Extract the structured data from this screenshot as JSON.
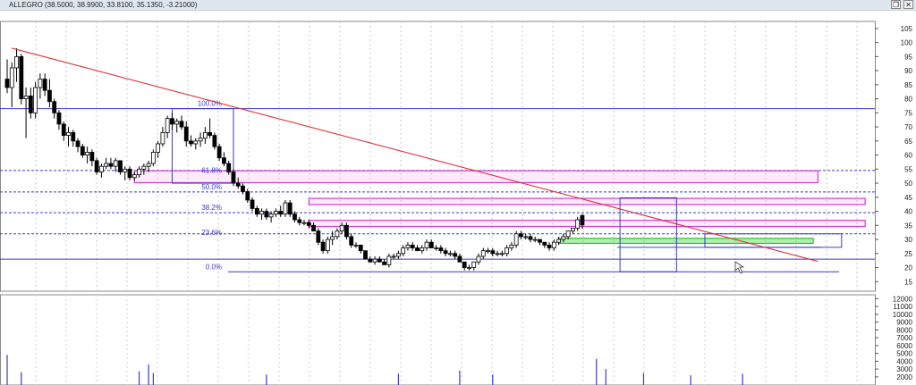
{
  "window": {
    "title": "ALLEGRO (38.5000, 38.9900, 33.8100, 35.1350, -3.21000)",
    "restore_glyph": "❐",
    "close_glyph": "✕",
    "restore_icon": "restore-window-icon",
    "close_icon": "close-window-icon"
  },
  "chart_data": [
    {
      "type": "candlestick",
      "symbol": "ALLEGRO",
      "header_values": {
        "open": 38.5,
        "high": 38.99,
        "low": 33.81,
        "close": 35.135,
        "change": -3.21
      },
      "y_ticks": [
        15,
        20,
        25,
        30,
        35,
        40,
        45,
        50,
        55,
        60,
        65,
        70,
        75,
        80,
        85,
        90,
        95,
        100,
        105
      ],
      "ylim": [
        11.6,
        107.5
      ],
      "grid": "vertical-dashed",
      "y_axis_side": "right",
      "colors": {
        "up_candle": "#ffffff",
        "down_candle": "#000000",
        "trendline": "#e0303a",
        "fib_levels": "#3b3bc8",
        "zones": "#d83ad8",
        "green_zone": "#22cc22",
        "volume": "#3b3bc8"
      },
      "fibonacci": [
        {
          "label": "100.0%",
          "price": 76.5
        },
        {
          "label": "61.8%",
          "price": 52.8
        },
        {
          "label": "50.0%",
          "price": 46.9
        },
        {
          "label": "38.2%",
          "price": 39.5
        },
        {
          "label": "23.6%",
          "price": 30.6
        },
        {
          "label": "0.0%",
          "price": 18.5
        }
      ],
      "horizontal_lines": [
        {
          "price": 76.5,
          "style": "solid"
        },
        {
          "price": 54.5,
          "style": "dashed"
        },
        {
          "price": 46.9,
          "style": "dashed"
        },
        {
          "price": 39.5,
          "style": "dashed"
        },
        {
          "price": 32.0,
          "style": "dashed"
        },
        {
          "price": 23.0,
          "style": "solid"
        },
        {
          "price": 27.2,
          "style": "solid"
        },
        {
          "price": 18.5,
          "style": "solid"
        }
      ],
      "zones": [
        {
          "bar_from": 27,
          "bar_to": 172,
          "price_low": 50.2,
          "price_high": 54.4,
          "color": "magenta"
        },
        {
          "bar_from": 64,
          "bar_to": 182,
          "price_low": 42.4,
          "price_high": 44.6,
          "color": "magenta"
        },
        {
          "bar_from": 64,
          "bar_to": 182,
          "price_low": 34.6,
          "price_high": 36.8,
          "color": "magenta"
        },
        {
          "bar_from": 117,
          "bar_to": 171,
          "price_low": 28.6,
          "price_high": 30.4,
          "color": "green"
        }
      ],
      "boxes": [
        {
          "bar_from": 35,
          "bar_to": 48,
          "price_low": 50.0,
          "price_high": 76.5
        },
        {
          "bar_from": 130,
          "bar_to": 142,
          "price_low": 18.5,
          "price_high": 44.8
        },
        {
          "bar_from": 148,
          "bar_to": 177,
          "price_low": 27.2,
          "price_high": 32.0
        }
      ],
      "trendline": {
        "from": {
          "bar": 1,
          "price": 98.0
        },
        "to": {
          "bar": 172,
          "price": 22.2
        }
      },
      "candles": [
        [
          87,
          94,
          82,
          84
        ],
        [
          84,
          93,
          77,
          91
        ],
        [
          91,
          98,
          86,
          95
        ],
        [
          95,
          96,
          78,
          80
        ],
        [
          80,
          84,
          66,
          81
        ],
        [
          81,
          84,
          73,
          75
        ],
        [
          75,
          86,
          73,
          84
        ],
        [
          84,
          89,
          80,
          87
        ],
        [
          87,
          89,
          81,
          83
        ],
        [
          83,
          87,
          77,
          79
        ],
        [
          79,
          80,
          73,
          75
        ],
        [
          75,
          76,
          69,
          71
        ],
        [
          71,
          72,
          65,
          67
        ],
        [
          67,
          70,
          63,
          68
        ],
        [
          68,
          69,
          63,
          65
        ],
        [
          65,
          66,
          61,
          63
        ],
        [
          63,
          64,
          59,
          60
        ],
        [
          60,
          63,
          57,
          61
        ],
        [
          61,
          62,
          56,
          58
        ],
        [
          58,
          59,
          53,
          54
        ],
        [
          54,
          57,
          52,
          56
        ],
        [
          56,
          59,
          55,
          57
        ],
        [
          57,
          59,
          55,
          56
        ],
        [
          56,
          59,
          54,
          58
        ],
        [
          58,
          58,
          53,
          54
        ],
        [
          54,
          56,
          51,
          55
        ],
        [
          55,
          56,
          51,
          52
        ],
        [
          52,
          54,
          51,
          53
        ],
        [
          53,
          56,
          52,
          55
        ],
        [
          55,
          57,
          53,
          56
        ],
        [
          56,
          58,
          54,
          57
        ],
        [
          57,
          62,
          56,
          61
        ],
        [
          61,
          65,
          59,
          64
        ],
        [
          64,
          70,
          63,
          68
        ],
        [
          68,
          74,
          66,
          73
        ],
        [
          73,
          75,
          69,
          71
        ],
        [
          71,
          73,
          68,
          72
        ],
        [
          72,
          74,
          69,
          70
        ],
        [
          70,
          72,
          63,
          65
        ],
        [
          65,
          67,
          63,
          64
        ],
        [
          64,
          66,
          62,
          65
        ],
        [
          65,
          68,
          63,
          66
        ],
        [
          66,
          70,
          64,
          68
        ],
        [
          68,
          73,
          66,
          67
        ],
        [
          67,
          68,
          62,
          63
        ],
        [
          63,
          64,
          58,
          59
        ],
        [
          59,
          61,
          56,
          57
        ],
        [
          57,
          58,
          53,
          54
        ],
        [
          54,
          55,
          49,
          50
        ],
        [
          50,
          52,
          48,
          49
        ],
        [
          49,
          50,
          46,
          47
        ],
        [
          47,
          48,
          43,
          44
        ],
        [
          44,
          45,
          40,
          41
        ],
        [
          41,
          42,
          38,
          39
        ],
        [
          39,
          41,
          37,
          40
        ],
        [
          40,
          41,
          37,
          38
        ],
        [
          38,
          40,
          36,
          39
        ],
        [
          39,
          41,
          38,
          40
        ],
        [
          40,
          42,
          38,
          39
        ],
        [
          39,
          44,
          38,
          43
        ],
        [
          43,
          44,
          38,
          39
        ],
        [
          39,
          40,
          36,
          37
        ],
        [
          37,
          38,
          35,
          36
        ],
        [
          36,
          37,
          35,
          36
        ],
        [
          36,
          37,
          34,
          35
        ],
        [
          35,
          36,
          33,
          33
        ],
        [
          33,
          34,
          28,
          29
        ],
        [
          29,
          30,
          25,
          26
        ],
        [
          26,
          31,
          25,
          30
        ],
        [
          30,
          33,
          28,
          31
        ],
        [
          31,
          34,
          30,
          33
        ],
        [
          33,
          36,
          32,
          35
        ],
        [
          35,
          36,
          30,
          31
        ],
        [
          31,
          32,
          27,
          28
        ],
        [
          28,
          29,
          27,
          28
        ],
        [
          28,
          28,
          25,
          26
        ],
        [
          26,
          26,
          23,
          23
        ],
        [
          23,
          24,
          22,
          22
        ],
        [
          22,
          24,
          21,
          23
        ],
        [
          23,
          24,
          22,
          22
        ],
        [
          22,
          23,
          21,
          21
        ],
        [
          21,
          25,
          20,
          24
        ],
        [
          24,
          25,
          23,
          24
        ],
        [
          24,
          26,
          23,
          25
        ],
        [
          25,
          28,
          24,
          27
        ],
        [
          27,
          29,
          26,
          28
        ],
        [
          28,
          29,
          26,
          27
        ],
        [
          27,
          28,
          26,
          26
        ],
        [
          26,
          28,
          25,
          27
        ],
        [
          27,
          30,
          26,
          29
        ],
        [
          29,
          30,
          27,
          27
        ],
        [
          27,
          28,
          26,
          27
        ],
        [
          27,
          28,
          25,
          26
        ],
        [
          26,
          27,
          24,
          25
        ],
        [
          25,
          26,
          24,
          25
        ],
        [
          25,
          26,
          23,
          24
        ],
        [
          24,
          25,
          22,
          22
        ],
        [
          22,
          22,
          19,
          20
        ],
        [
          20,
          21,
          19,
          20
        ],
        [
          20,
          22,
          19,
          22
        ],
        [
          22,
          25,
          21,
          24
        ],
        [
          24,
          27,
          23,
          26
        ],
        [
          26,
          27,
          25,
          26
        ],
        [
          26,
          27,
          24,
          25
        ],
        [
          25,
          26,
          24,
          25
        ],
        [
          25,
          26,
          24,
          25
        ],
        [
          25,
          28,
          24,
          27
        ],
        [
          27,
          29,
          26,
          28
        ],
        [
          28,
          33,
          27,
          32
        ],
        [
          32,
          33,
          30,
          31
        ],
        [
          31,
          32,
          30,
          31
        ],
        [
          31,
          32,
          29,
          30
        ],
        [
          30,
          31,
          29,
          30
        ],
        [
          30,
          30,
          28,
          29
        ],
        [
          29,
          29,
          27,
          28
        ],
        [
          28,
          29,
          26,
          27
        ],
        [
          27,
          30,
          26,
          29
        ],
        [
          29,
          31,
          28,
          30
        ],
        [
          30,
          32,
          29,
          31
        ],
        [
          31,
          33,
          30,
          33
        ],
        [
          33,
          34,
          32,
          34
        ],
        [
          34,
          38,
          33,
          37
        ],
        [
          38.5,
          38.99,
          33.81,
          35.135
        ]
      ],
      "volume_ticks": [
        2000,
        3000,
        4000,
        5000,
        6000,
        7000,
        8000,
        9000,
        10000,
        11000,
        12000
      ],
      "volume_ylim": [
        1300,
        12500
      ],
      "volume_spikes": [
        {
          "bar": 0,
          "value": 4800
        },
        {
          "bar": 3,
          "value": 2600
        },
        {
          "bar": 28,
          "value": 2700
        },
        {
          "bar": 30,
          "value": 3600
        },
        {
          "bar": 31,
          "value": 2500
        },
        {
          "bar": 55,
          "value": 2300
        },
        {
          "bar": 83,
          "value": 2400
        },
        {
          "bar": 96,
          "value": 2800
        },
        {
          "bar": 103,
          "value": 2300
        },
        {
          "bar": 125,
          "value": 4300
        },
        {
          "bar": 127,
          "value": 3000
        },
        {
          "bar": 135,
          "value": 2500
        },
        {
          "bar": 145,
          "value": 2200
        },
        {
          "bar": 156,
          "value": 2400
        }
      ]
    }
  ]
}
